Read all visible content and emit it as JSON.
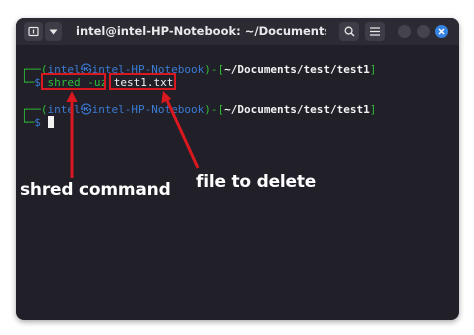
{
  "window": {
    "title": "intel@intel-HP-Notebook: ~/Documents/tes..."
  },
  "terminal": {
    "lines": [
      {
        "prefix": "┌──(",
        "user": "intel㉿intel-HP-Notebook",
        "mid": ")-[",
        "path": "~/Documents/test/test1",
        "end": "]"
      },
      {
        "prefix": "└─",
        "prompt": "$ ",
        "command": "shred -uz",
        "arg": "test1.txt"
      },
      {
        "prefix": "┌──(",
        "user": "intel㉿intel-HP-Notebook",
        "mid": ")-[",
        "path": "~/Documents/test/test1",
        "end": "]"
      },
      {
        "prefix": "└─",
        "prompt": "$ "
      }
    ]
  },
  "annotations": {
    "shred_label": "shred command",
    "file_label": "file to delete",
    "color": "#d9181f"
  },
  "colors": {
    "terminal_bg": "#211f28",
    "titlebar_bg": "#2c2a33",
    "prompt_green": "#2fbf3a",
    "host_blue": "#3a7bd5",
    "close_blue": "#3584e4"
  },
  "icons": {
    "new_tab": "new-tab-icon",
    "dropdown": "chevron-down-icon",
    "search": "search-icon",
    "menu": "hamburger-menu-icon",
    "close": "close-icon"
  }
}
